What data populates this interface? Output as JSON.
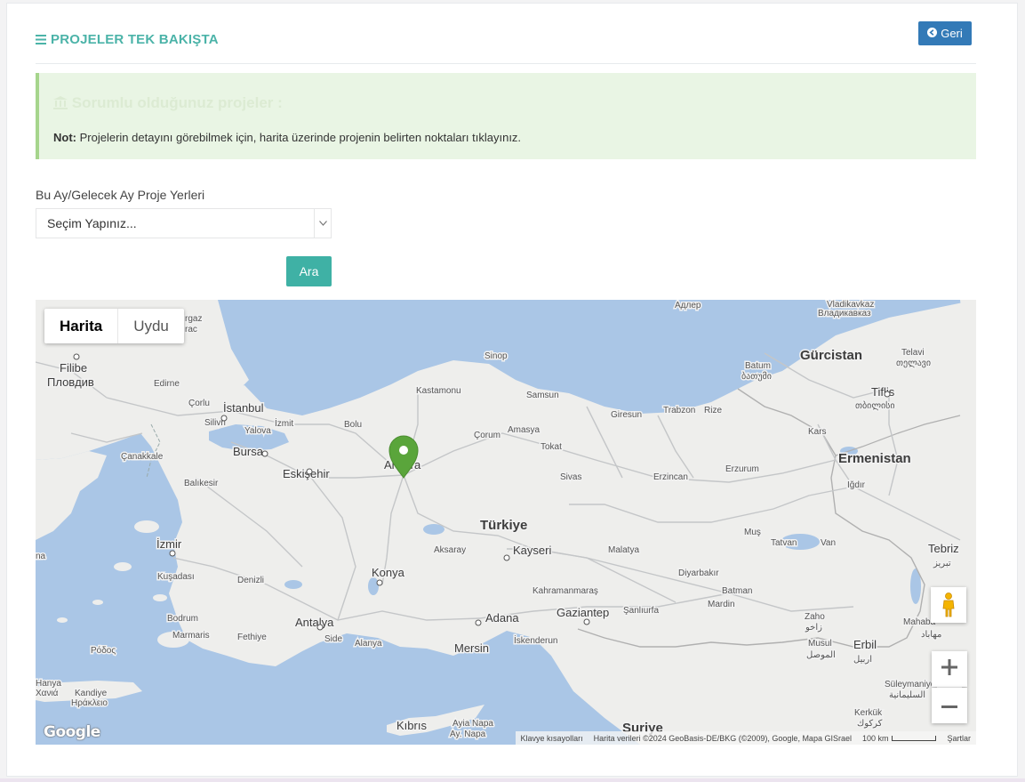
{
  "header": {
    "title": "PROJELER TEK BAKIŞTA",
    "title_icon": "menu-icon",
    "back_label": "Geri",
    "back_icon": "arrow-left-icon"
  },
  "notice": {
    "heading": "Sorumlu olduğunuz projeler :",
    "heading_icon": "bank-icon",
    "note_label": "Not:",
    "note_text": " Projelerin detayını görebilmek için, harita üzerinde projenin belirten noktaları tıklayınız."
  },
  "filter": {
    "label": "Bu Ay/Gelecek Ay Proje Yerleri",
    "selected": "Seçim Yapınız...",
    "search_label": "Ara"
  },
  "map": {
    "type_tabs": [
      "Harita",
      "Uydu"
    ],
    "attribution": {
      "shortcuts": "Klavye kısayolları",
      "data": "Harita verileri ©2024 GeoBasis-DE/BKG (©2009), Google, Mapa GISrael",
      "scale": "100 km",
      "terms": "Şartlar"
    },
    "logo": "Google",
    "labels": {
      "turkiye": "Türkiye",
      "gurcistan": "Gürcistan",
      "ermenistan": "Ermenistan",
      "istanbul": "İstanbul",
      "bursa": "Bursa",
      "eskisehir": "Eskişehir",
      "ankara": "Ankara",
      "izmir": "İzmir",
      "konya": "Konya",
      "antalya": "Antalya",
      "adana": "Adana",
      "mersin": "Mersin",
      "gaziantep": "Gaziantep",
      "kayseri": "Kayseri",
      "kibris": "Kıbrıs",
      "suriye": "Suriye",
      "erbil": "Erbil",
      "erbil_ar": "اربيل",
      "tebriz": "Tebriz",
      "tebriz_fa": "تبریز",
      "tiflis": "Tiflis",
      "tiflis_ka": "თბილისი",
      "filibe": "Filibe",
      "filibe_bg": "Пловдив",
      "sinop": "Sinop",
      "samsun": "Samsun",
      "kastamonu": "Kastamonu",
      "trabzon": "Trabzon",
      "rize": "Rize",
      "giresun": "Giresun",
      "corum": "Çorum",
      "amasya": "Amasya",
      "tokat": "Tokat",
      "sivas": "Sivas",
      "erzincan": "Erzincan",
      "erzurum": "Erzurum",
      "kars": "Kars",
      "igdir": "Iğdır",
      "batum": "Batum",
      "batum_ka": "ბათუმი",
      "telavi": "Telavi",
      "telavi_ka": "თელავი",
      "vladikavkaz": "Vladikavkaz",
      "vladikavkaz_ru": "Владикавказ",
      "adler": "Адлер",
      "bolu": "Bolu",
      "izmit": "İzmit",
      "yalova": "Yalova",
      "silivri": "Silivri",
      "corlu": "Çorlu",
      "edirne": "Edirne",
      "canakkale": "Çanakkale",
      "balikesir": "Balıkesir",
      "kusadasi": "Kuşadası",
      "denizli": "Denizli",
      "bodrum": "Bodrum",
      "marmaris": "Marmaris",
      "fethiye": "Fethiye",
      "side": "Side",
      "alanya": "Alanya",
      "aksaray": "Aksaray",
      "malatya": "Malatya",
      "diyarbakir": "Diyarbakır",
      "batman": "Batman",
      "mardin": "Mardin",
      "mus": "Muş",
      "tatvan": "Tatvan",
      "van": "Van",
      "kahramanmaras": "Kahramanmaraş",
      "sanliurfa": "Şanlıurfa",
      "iskenderun": "İskenderun",
      "zaho": "Zaho",
      "zaho_ar": "زاخو",
      "musul": "Musul",
      "musul_ar": "الموصل",
      "suleymaniye": "Süleymaniye",
      "suleymaniye_ar": "السليمانية",
      "kerkuk": "Kerkük",
      "kerkuk_ar": "كركوك",
      "mahabad": "Mahaba",
      "mahabad_fa": "مهاباد",
      "kandiye": "Kandiye",
      "kandiye_el": "Ηράκλειο",
      "hanya": "Hanya",
      "hanya_el": "Χανιά",
      "rodos_el": "Ρόδος",
      "ayia_napa": "Ayia Napa",
      "ay_napa": "Ay. Napa",
      "tirgaz": "rgaz",
      "trac": "rac",
      "na": "na"
    }
  }
}
